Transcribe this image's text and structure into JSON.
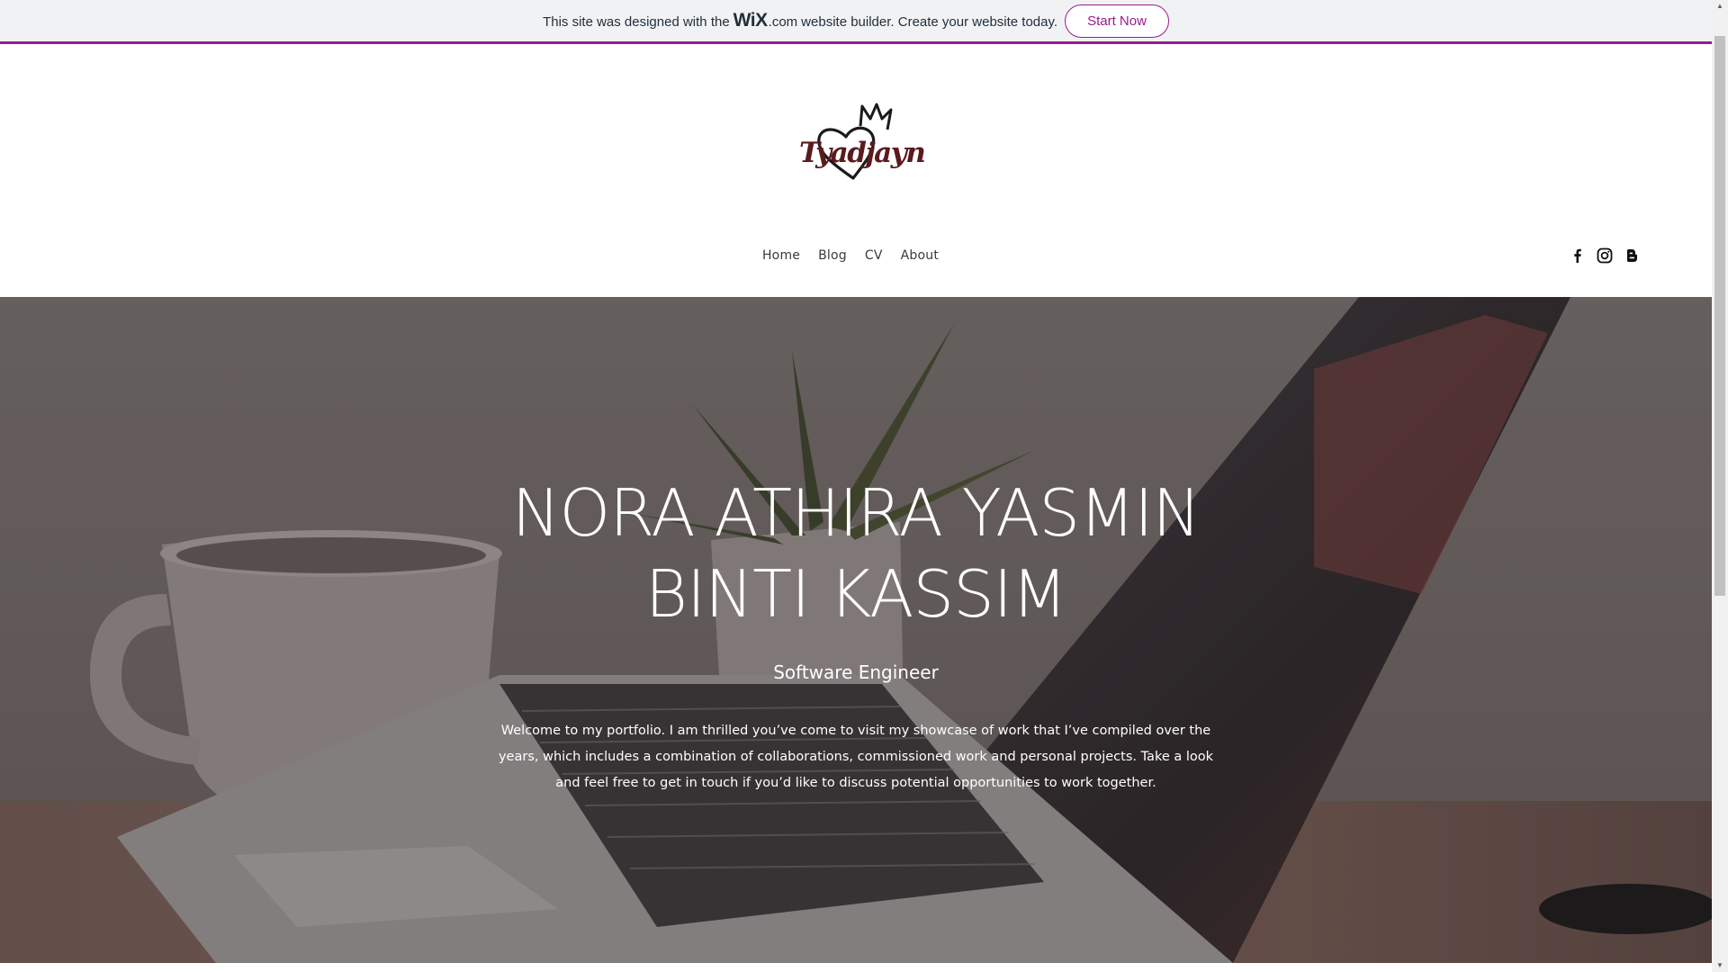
{
  "banner": {
    "text_before": "This site was designed with the",
    "wix_logo": "WiX",
    "wix_com": ".com",
    "text_after": "website builder. Create your website today.",
    "start_label": "Start Now",
    "accent_color": "#9a1b8c"
  },
  "header": {
    "logo_text": "Tyadjayn",
    "logo_icons": [
      "crown-icon",
      "heart-icon"
    ],
    "nav": [
      {
        "label": "Home"
      },
      {
        "label": "Blog"
      },
      {
        "label": "CV"
      },
      {
        "label": "About"
      }
    ],
    "social": [
      "facebook-icon",
      "instagram-icon",
      "blogger-icon"
    ]
  },
  "hero": {
    "title_line1": "NORA ATHIRA YASMIN",
    "title_line2": "BINTI KASSIM",
    "subtitle": "Software Engineer",
    "body": "Welcome to my portfolio. I am thrilled you’ve come to visit my showcase of work that I’ve compiled over the years, which includes a combination of collaborations, commissioned work and personal projects. Take a look and feel free to get in touch if you’d like to discuss potential opportunities to work together."
  }
}
